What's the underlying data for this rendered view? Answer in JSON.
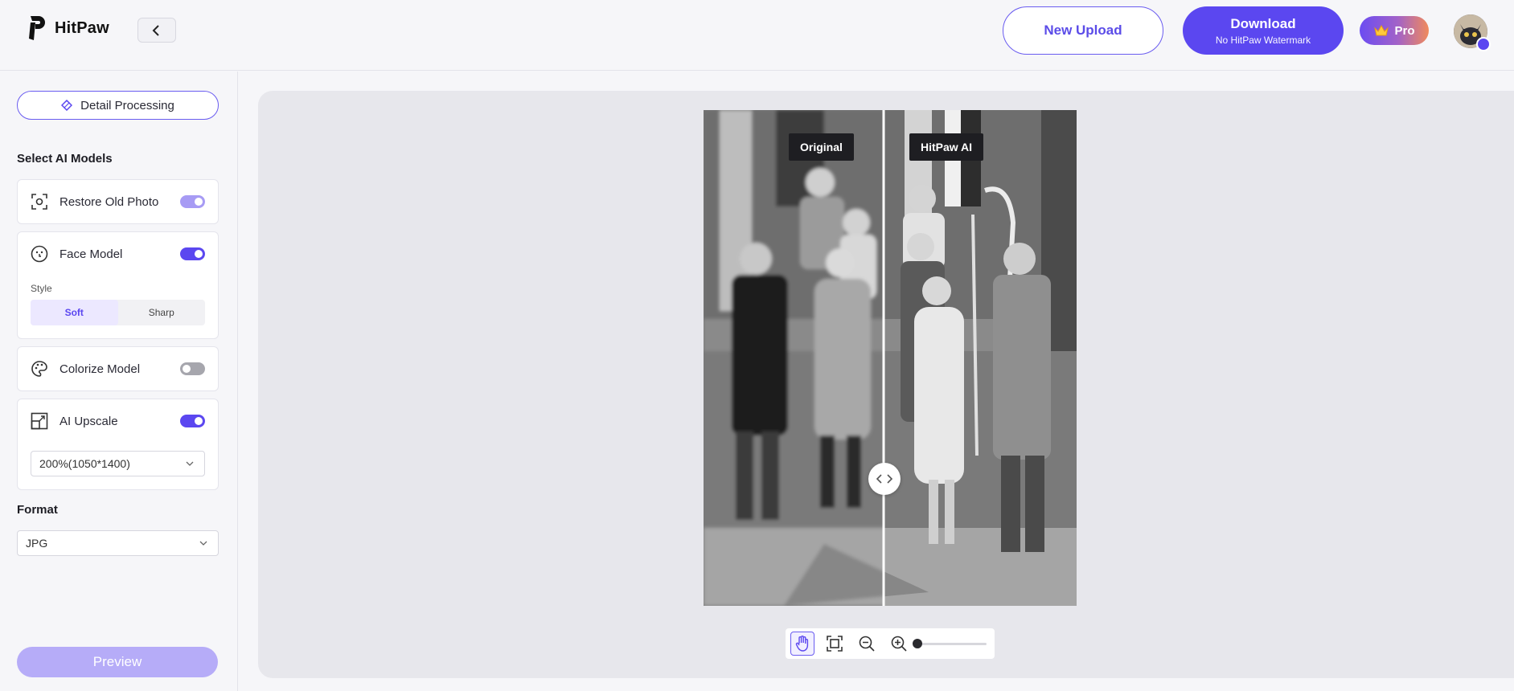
{
  "header": {
    "brand": "HitPaw",
    "new_upload": "New Upload",
    "download_main": "Download",
    "download_sub": "No HitPaw Watermark",
    "pro": "Pro"
  },
  "sidebar": {
    "detail_processing": "Detail Processing",
    "select_models_title": "Select AI Models",
    "models": [
      {
        "label": "Restore Old Photo",
        "enabled": true
      },
      {
        "label": "Face Model",
        "enabled": true
      },
      {
        "label": "Colorize Model",
        "enabled": false
      },
      {
        "label": "AI Upscale",
        "enabled": true
      }
    ],
    "style_label": "Style",
    "style_options": [
      "Soft",
      "Sharp"
    ],
    "style_selected": "Soft",
    "upscale_value": "200%(1050*1400)",
    "format_title": "Format",
    "format_value": "JPG",
    "preview": "Preview"
  },
  "viewer": {
    "left_tag": "Original",
    "right_tag": "HitPaw AI",
    "zoom_level": 0
  },
  "colors": {
    "accent": "#5b47f0",
    "accent_light": "#b6acf8"
  }
}
